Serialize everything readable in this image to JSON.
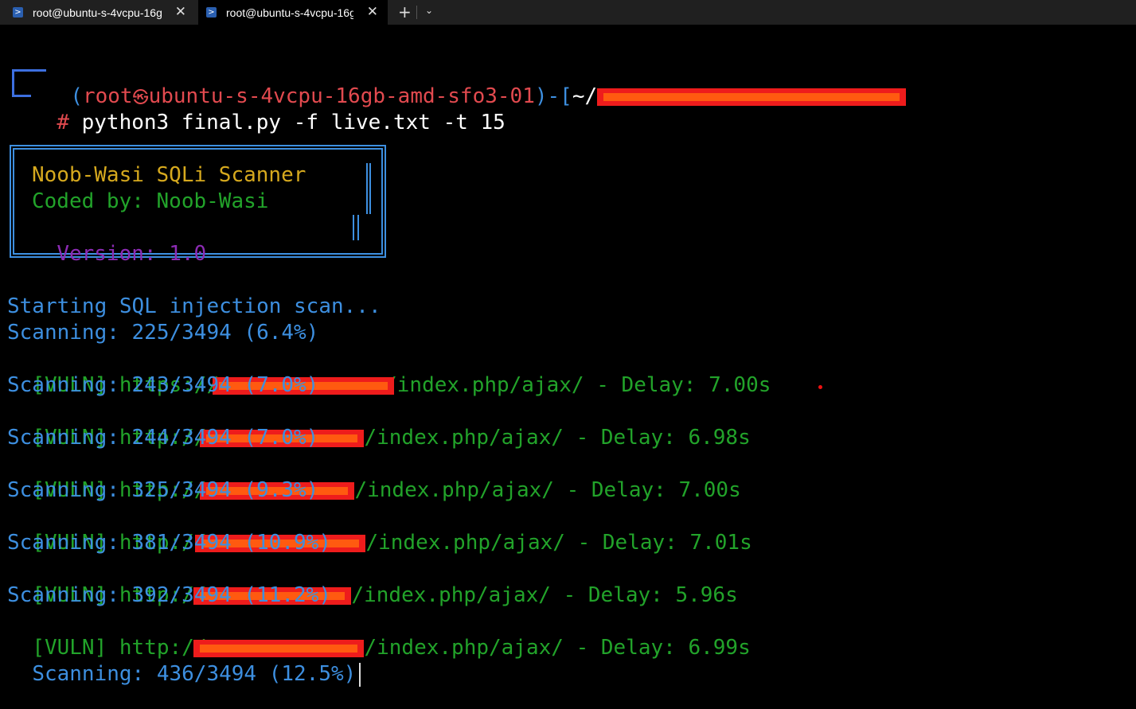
{
  "tabs": [
    {
      "title": "root@ubuntu-s-4vcpu-16g",
      "active": false
    },
    {
      "title": "root@ubuntu-s-4vcpu-16g",
      "active": true
    }
  ],
  "tabbar": {
    "new_tab": "+",
    "dropdown": "⌄",
    "close": "✕",
    "shell_icon": "powershell-icon"
  },
  "prompt": {
    "open": "(",
    "user": "root",
    "host_separator": "㉿",
    "host": "ubuntu-s-4vcpu-16gb-amd-sfo3-01",
    "close_dir_open": ")-[",
    "dir": "~/",
    "hash": "#",
    "command": "python3 final.py -f live.txt -t 15"
  },
  "banner": {
    "title": "Noob-Wasi SQLi Scanner",
    "author": "Coded by: Noob-Wasi",
    "version_label": "Version: ",
    "version": "1.0"
  },
  "output": {
    "start": "Starting SQL injection scan...",
    "lines": [
      {
        "kind": "scan",
        "text": "Scanning: 225/3494 (6.4%)"
      },
      {
        "kind": "vuln",
        "prefix": "[VULN] https://",
        "suffix": "/index.php/ajax/ - Delay: 7.00s"
      },
      {
        "kind": "scan",
        "text": "Scanning: 243/3494 (7.0%)"
      },
      {
        "kind": "vuln",
        "prefix": "[VULN] http://",
        "suffix": "/index.php/ajax/ - Delay: 6.98s"
      },
      {
        "kind": "scan",
        "text": "Scanning: 244/3494 (7.0%)"
      },
      {
        "kind": "vuln",
        "prefix": "[VULN] http://",
        "suffix": "/index.php/ajax/ - Delay: 7.00s"
      },
      {
        "kind": "scan",
        "text": "Scanning: 325/3494 (9.3%)"
      },
      {
        "kind": "vuln",
        "prefix": "[VULN] http://",
        "suffix": "/index.php/ajax/ - Delay: 7.01s"
      },
      {
        "kind": "scan",
        "text": "Scanning: 381/3494 (10.9%)"
      },
      {
        "kind": "vuln",
        "prefix": "[VULN] http://",
        "suffix": "/index.php/ajax/ - Delay: 5.96s"
      },
      {
        "kind": "scan",
        "text": "Scanning: 392/3494 (11.2%)"
      },
      {
        "kind": "vuln",
        "prefix": "[VULN] http://",
        "suffix": "/index.php/ajax/ - Delay: 6.99s"
      },
      {
        "kind": "scan",
        "text": "Scanning: 436/3494 (12.5%)"
      }
    ]
  },
  "colors": {
    "background": "#000000",
    "prompt_user": "#e24a4f",
    "prompt_frame": "#3d6fe0",
    "scan": "#3d8fe0",
    "vuln": "#22a32a",
    "banner_title": "#d6a91e",
    "banner_version": "#8c2bb4",
    "redaction": "#ee1c1c"
  }
}
